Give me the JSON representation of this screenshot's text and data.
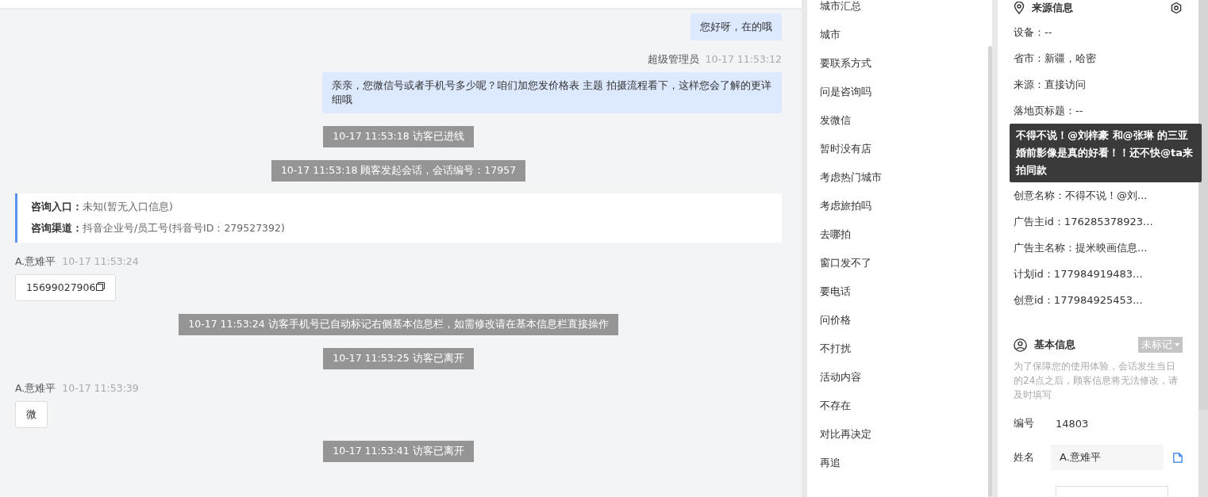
{
  "chat": {
    "messages": [
      {
        "kind": "agent_bubble",
        "text": "您好呀，在的哦"
      },
      {
        "kind": "agent_meta",
        "name": "超级管理员",
        "time": "10-17 11:53:12"
      },
      {
        "kind": "agent_bubble",
        "text": "亲亲，您微信号或者手机号多少呢？咱们加您发价格表 主题 拍摄流程看下，这样您会了解的更详细哦"
      },
      {
        "kind": "system",
        "text": "10-17 11:53:18 访客已进线"
      },
      {
        "kind": "system",
        "text": "10-17 11:53:18 顾客发起会话，会话编号：17957"
      },
      {
        "kind": "info_card",
        "rows": [
          {
            "label": "咨询入口：",
            "value": "未知(暂无入口信息)"
          },
          {
            "label": "咨询渠道：",
            "value": "抖音企业号/员工号(抖音号ID：279527392)"
          }
        ]
      },
      {
        "kind": "visitor_meta",
        "name": "A.意难平",
        "time": "10-17 11:53:24"
      },
      {
        "kind": "visitor_bubble",
        "text": "15699027906",
        "copyable": true
      },
      {
        "kind": "system",
        "text": "10-17 11:53:24 访客手机号已自动标记右侧基本信息栏，如需修改请在基本信息栏直接操作"
      },
      {
        "kind": "system",
        "text": "10-17 11:53:25 访客已离开"
      },
      {
        "kind": "visitor_meta",
        "name": "A.意难平",
        "time": "10-17 11:53:39"
      },
      {
        "kind": "visitor_bubble",
        "text": "微",
        "copyable": false
      },
      {
        "kind": "system",
        "text": "10-17 11:53:41 访客已离开"
      }
    ]
  },
  "quick_replies": [
    "城市汇总",
    "城市",
    "要联系方式",
    "问是咨询吗",
    "发微信",
    "暂时没有店",
    "考虑热门城市",
    "考虑旅拍吗",
    "去哪拍",
    "窗口发不了",
    "要电话",
    "问价格",
    "不打扰",
    "活动内容",
    "不存在",
    "对比再决定",
    "再追"
  ],
  "source_info": {
    "title": "来源信息",
    "fields": [
      {
        "kind": "field",
        "text": "设备：--"
      },
      {
        "kind": "field",
        "text": "省市：新疆，哈密"
      },
      {
        "kind": "field",
        "text": "来源：直接访问"
      },
      {
        "kind": "field",
        "text": "落地页标题：--"
      },
      {
        "kind": "tooltip",
        "text": "不得不说！@刘梓豪 和@张琳 的三亚婚前影像是真的好看！！还不快@ta来拍同款"
      },
      {
        "kind": "field",
        "text": "创意名称：不得不说！@刘..."
      },
      {
        "kind": "field",
        "text": "广告主id：176285378923..."
      },
      {
        "kind": "field",
        "text": "广告主名称：提米映画信息..."
      },
      {
        "kind": "field",
        "text": "计划id：177984919483..."
      },
      {
        "kind": "field",
        "text": "创意id：177984925453..."
      }
    ]
  },
  "basic_info": {
    "title": "基本信息",
    "tag": "未标记",
    "note": "为了保障您的使用体验，会话发生当日的24点之后，顾客信息将无法修改，请及时填写",
    "number_label": "编号",
    "number": "14803",
    "name_label": "姓名",
    "name_value": "A.意难平"
  }
}
